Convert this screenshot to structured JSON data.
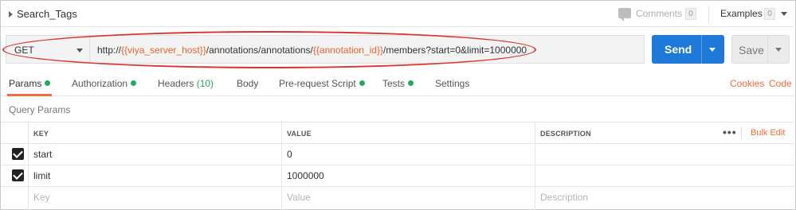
{
  "request": {
    "title": "Search_Tags",
    "comments_label": "Comments",
    "comments_count": "0",
    "examples_label": "Examples",
    "examples_count": "0"
  },
  "url_bar": {
    "method": "GET",
    "url_prefix": "http://",
    "url_var1": "{{viya_server_host}}",
    "url_mid": "/annotations/annotations/",
    "url_var2": "{{annotation_id}}",
    "url_suffix": "/members?start=0&limit=1000000",
    "send_label": "Send",
    "save_label": "Save"
  },
  "tabs": {
    "params": "Params",
    "authorization": "Authorization",
    "headers": "Headers",
    "headers_count": "(10)",
    "body": "Body",
    "prerequest": "Pre-request Script",
    "tests": "Tests",
    "settings": "Settings",
    "cookies": "Cookies",
    "code": "Code"
  },
  "query_params": {
    "title": "Query Params",
    "columns": {
      "key": "KEY",
      "value": "VALUE",
      "description": "DESCRIPTION"
    },
    "more": "•••",
    "bulk_edit": "Bulk Edit",
    "rows": [
      {
        "key": "start",
        "value": "0",
        "checked": true
      },
      {
        "key": "limit",
        "value": "1000000",
        "checked": true
      }
    ],
    "placeholder": {
      "key": "Key",
      "value": "Value",
      "description": "Description"
    }
  },
  "colors": {
    "send": "#1f79d8",
    "accent": "#f26b3a",
    "status_dot": "#27a85b",
    "highlight": "#d9342b"
  }
}
